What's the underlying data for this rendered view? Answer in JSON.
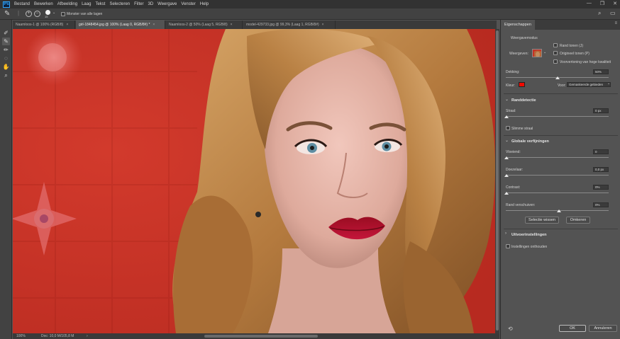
{
  "app": {
    "logo": "Ps"
  },
  "menu": [
    "Bestand",
    "Bewerken",
    "Afbeelding",
    "Laag",
    "Tekst",
    "Selecteren",
    "Filter",
    "3D",
    "Weergave",
    "Venster",
    "Help"
  ],
  "window_controls": [
    "—",
    "❐",
    "✕"
  ],
  "options_bar": {
    "brush_size": "15",
    "sample_all_layers_label": "Monster van alle lagen"
  },
  "tabs": [
    {
      "label": "Naamloos-1 @ 100% (RGB/8)",
      "close": "×"
    },
    {
      "label": "girl-1848454.jpg @ 100% (Laag 0, RGB/8#) *",
      "close": "×"
    },
    {
      "label": "Naamloos-2 @ 50% (Laag 5, RGB/8)",
      "close": "×"
    },
    {
      "label": "model-429733.jpg @ 99,3% (Laag 1, RGB/8#)",
      "close": "×"
    }
  ],
  "status_bar": {
    "zoom": "100%",
    "doc": "Doc: 10,0 M/105,8 M",
    "arrow": "›"
  },
  "panel": {
    "tab": "Eigenschappen",
    "view_mode_title": "Weergavemodus",
    "view_label": "Weergeven:",
    "show_edge_label": "Rand tonen (J)",
    "show_original_label": "Origineel tonen (P)",
    "high_quality_label": "Voorvertoning van hoge kwaliteit",
    "opacity_label": "Dekking:",
    "opacity_value": "50%",
    "opacity_fraction": 0.5,
    "color_label": "Kleur:",
    "color_value": "#f20a00",
    "from_label": "Voor:",
    "from_value": "Gemaskeerde gebieden",
    "edge_detection_title": "Randdetectie",
    "radius_label": "Straal:",
    "radius_value": "0 px",
    "smart_radius_label": "Slimme straal",
    "global_refinements_title": "Globale verfijningen",
    "smooth_label": "Vloeiend:",
    "smooth_value": "0",
    "feather_label": "Doezelaar:",
    "feather_value": "0,0 px",
    "contrast_label": "Contrast:",
    "contrast_value": "0%",
    "shift_edge_label": "Rand verschuiven:",
    "shift_edge_value": "0%",
    "clear_selection_label": "Selectie wissen",
    "invert_label": "Omkeren",
    "output_settings_title": "Uitvoerinstellingen",
    "remember_settings_label": "Instellingen onthouden",
    "ok_label": "OK",
    "cancel_label": "Annuleren"
  },
  "colors": {
    "accent": "#31a8ff",
    "canvas_background": "#c43226",
    "mask_color": "#f20a00"
  },
  "icons": [
    "brush-icon",
    "quick-selection-icon",
    "refine-edge-brush-icon",
    "brush-tool-icon",
    "lasso-icon",
    "hand-icon",
    "zoom-icon",
    "search-icon",
    "workspace-icon",
    "reset-icon"
  ]
}
